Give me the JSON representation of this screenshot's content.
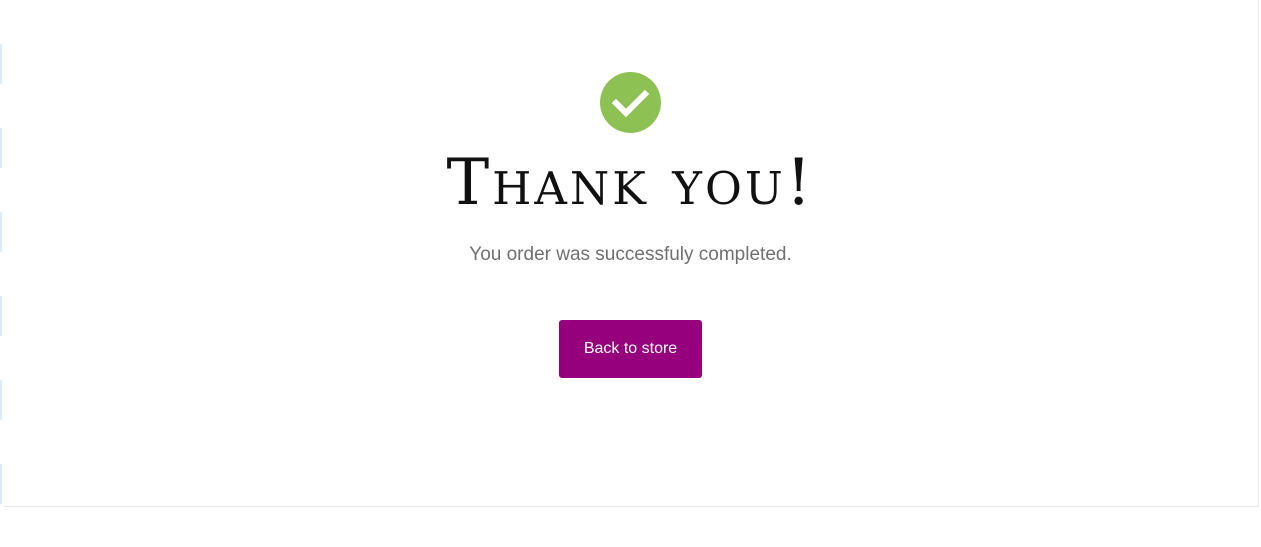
{
  "confirmation": {
    "icon": "check-circle-icon",
    "title": "Thank you!",
    "message": "You order was successfuly completed.",
    "back_button_label": "Back to store"
  },
  "colors": {
    "check_circle": "#8dc153",
    "button_background": "#96007d",
    "button_text": "#ffffff",
    "title_text": "#111111",
    "message_text": "#707070"
  }
}
